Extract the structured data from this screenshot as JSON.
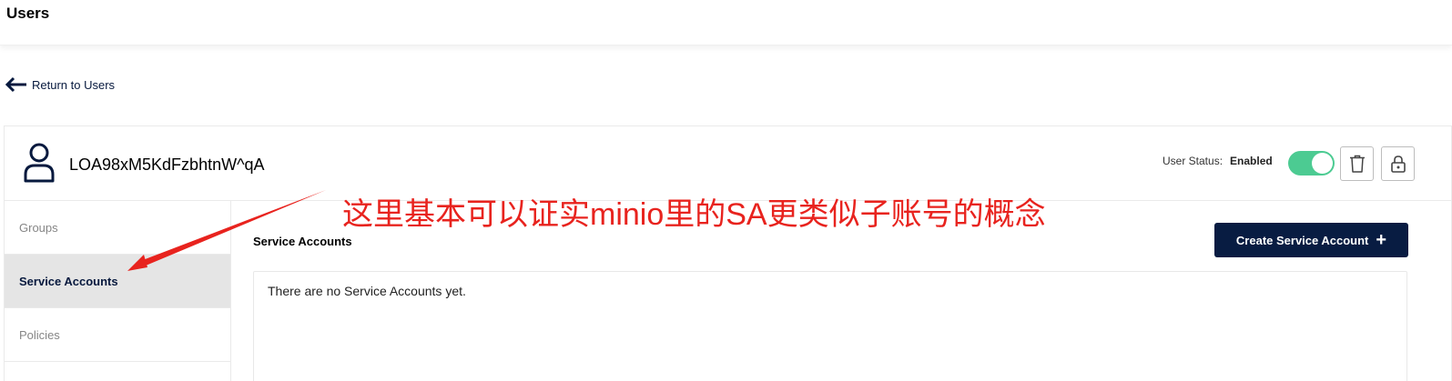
{
  "header": {
    "title": "Users"
  },
  "nav": {
    "return_label": "Return to Users"
  },
  "user": {
    "name": "LOA98xM5KdFzbhtnW^qA",
    "status_label": "User Status:",
    "status_value": "Enabled",
    "enabled": true
  },
  "sidebar": {
    "items": [
      {
        "label": "Groups",
        "active": false
      },
      {
        "label": "Service Accounts",
        "active": true
      },
      {
        "label": "Policies",
        "active": false
      }
    ]
  },
  "main": {
    "section_title": "Service Accounts",
    "create_button_label": "Create Service Account",
    "empty_message": "There are no Service Accounts yet."
  },
  "annotation": {
    "text": "这里基本可以证实minio里的SA更类似子账号的概念"
  },
  "colors": {
    "primary": "#081c42",
    "toggle_on": "#4ccb92",
    "annotation": "#e8231e",
    "active_bg": "#e5e5e5"
  }
}
